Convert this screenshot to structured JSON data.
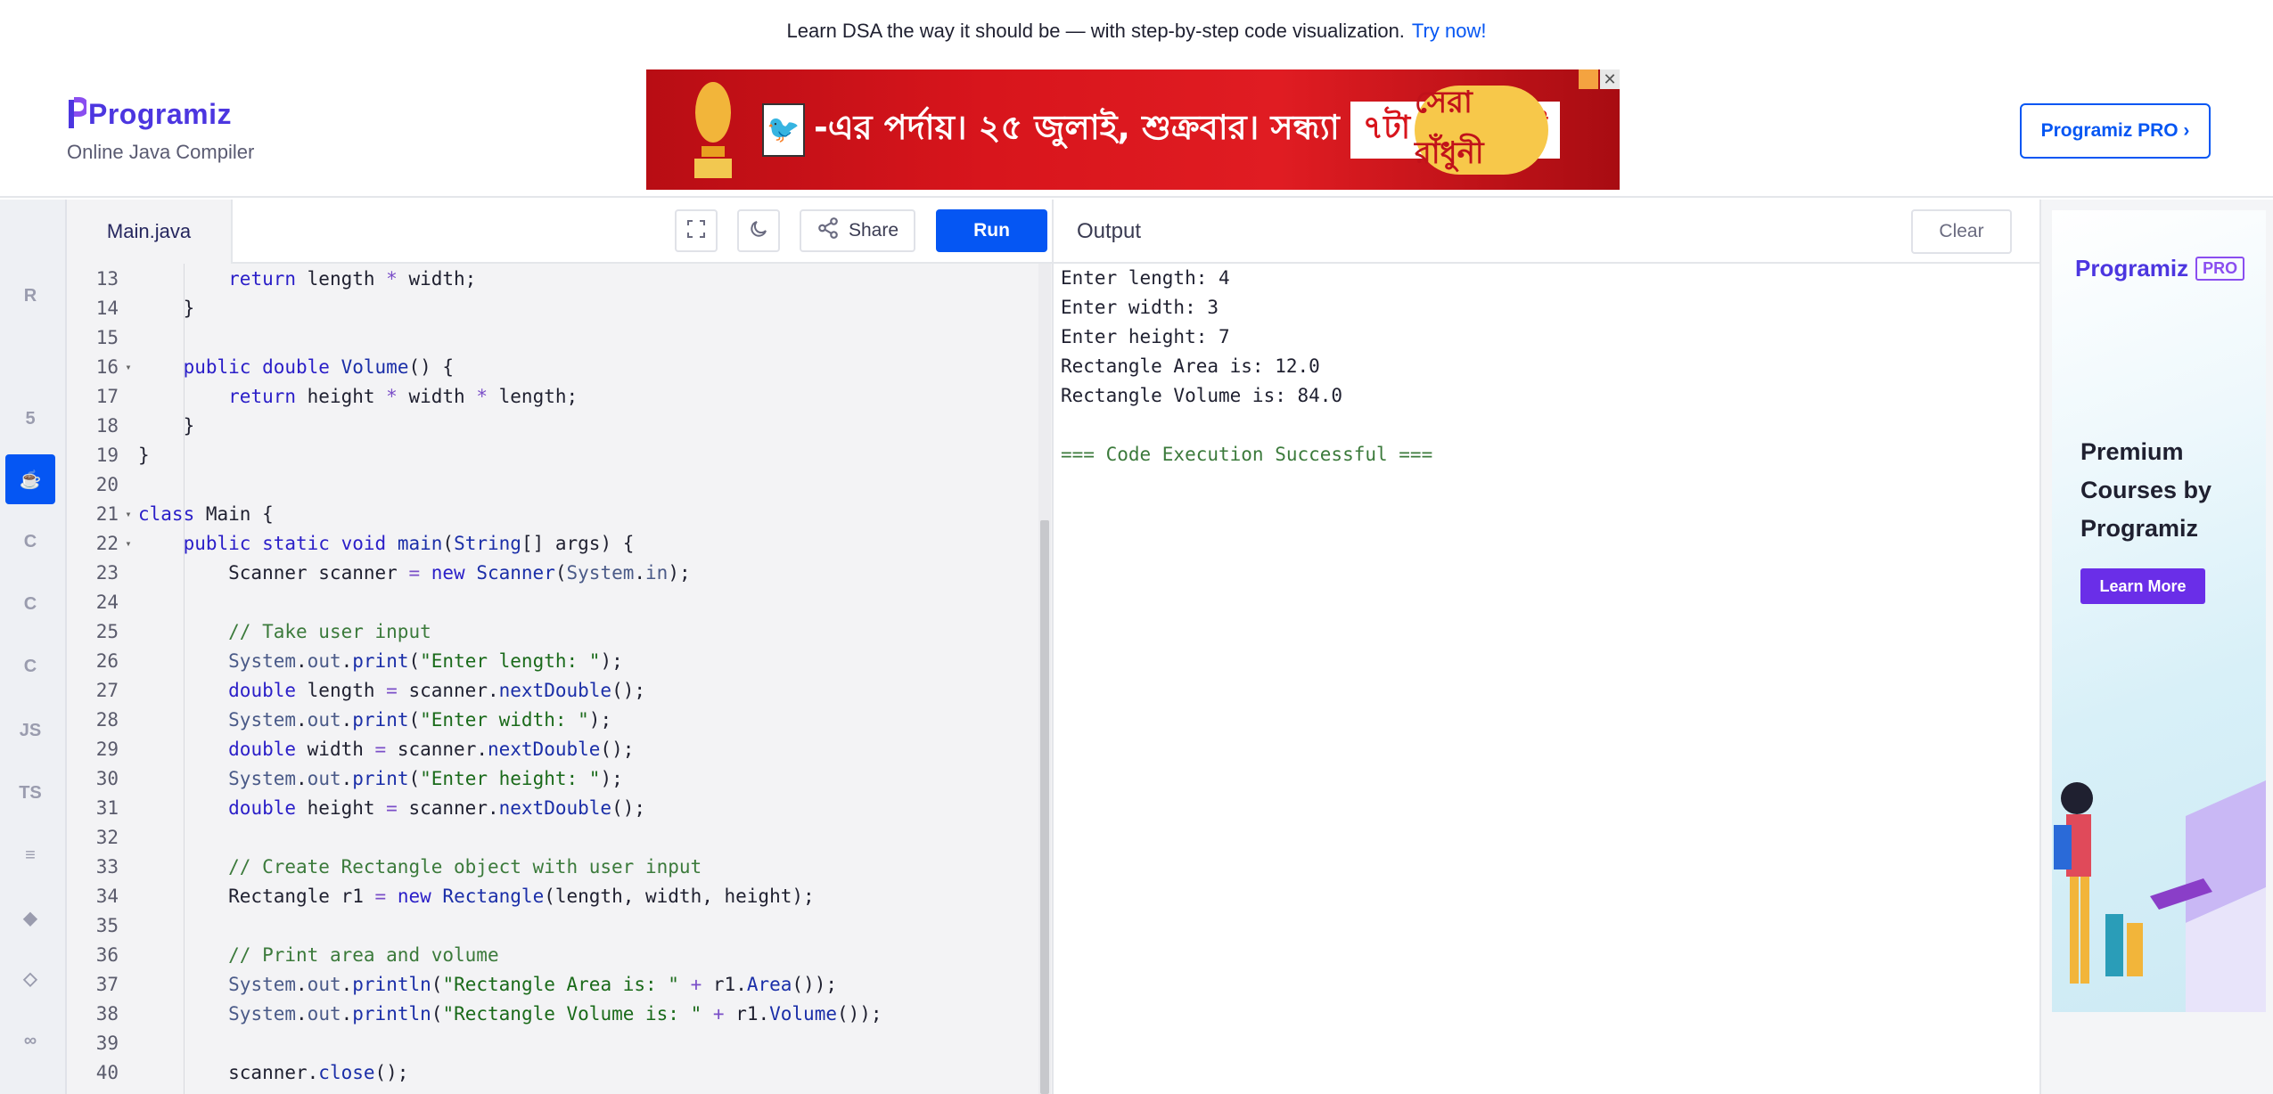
{
  "banner": {
    "text": "Learn DSA the way it should be — with step-by-step code visualization.",
    "cta": "Try now!"
  },
  "header": {
    "logo_text": "Programiz",
    "subtitle": "Online Java Compiler",
    "pro_button": "Programiz PRO ›"
  },
  "ad_top": {
    "text": "-এর পর্দায়। ২৫ জুলাই, শুক্রবার। সন্ধ্যা",
    "time": "৭টা ৩০ মিনিট",
    "brand": "সেরা রাঁধুনী",
    "close": "✕"
  },
  "rail": {
    "items": [
      {
        "icon": "python-icon",
        "label": ""
      },
      {
        "icon": "r-icon",
        "label": "R"
      },
      {
        "icon": "database-icon",
        "label": ""
      },
      {
        "icon": "html-icon",
        "label": "5"
      },
      {
        "icon": "java-icon",
        "label": "☕",
        "active": true
      },
      {
        "icon": "c-icon",
        "label": "C"
      },
      {
        "icon": "cpp-icon",
        "label": "C"
      },
      {
        "icon": "csharp-icon",
        "label": "C"
      },
      {
        "icon": "js-icon",
        "label": "JS"
      },
      {
        "icon": "ts-icon",
        "label": "TS"
      },
      {
        "icon": "stack-icon",
        "label": "≡"
      },
      {
        "icon": "swift-icon",
        "label": "◆"
      },
      {
        "icon": "kotlin-icon",
        "label": "◇"
      },
      {
        "icon": "go-icon",
        "label": "∞"
      }
    ]
  },
  "editor": {
    "file_tab": "Main.java",
    "share_label": "Share",
    "run_label": "Run",
    "lines": [
      {
        "n": "13",
        "fold": "",
        "code": [
          [
            "",
            "        "
          ],
          [
            "kw",
            "return"
          ],
          [
            "",
            " length "
          ],
          [
            "op",
            "*"
          ],
          [
            "",
            " width;"
          ]
        ]
      },
      {
        "n": "14",
        "fold": "",
        "code": [
          [
            "",
            "    }"
          ]
        ]
      },
      {
        "n": "15",
        "fold": "",
        "code": []
      },
      {
        "n": "16",
        "fold": "▾",
        "code": [
          [
            "",
            "    "
          ],
          [
            "kw",
            "public"
          ],
          [
            "",
            " "
          ],
          [
            "kw",
            "double"
          ],
          [
            "",
            " "
          ],
          [
            "fn",
            "Volume"
          ],
          [
            "",
            "() {"
          ]
        ]
      },
      {
        "n": "17",
        "fold": "",
        "code": [
          [
            "",
            "        "
          ],
          [
            "kw",
            "return"
          ],
          [
            "",
            " height "
          ],
          [
            "op",
            "*"
          ],
          [
            "",
            " width "
          ],
          [
            "op",
            "*"
          ],
          [
            "",
            " length;"
          ]
        ]
      },
      {
        "n": "18",
        "fold": "",
        "code": [
          [
            "",
            "    }"
          ]
        ]
      },
      {
        "n": "19",
        "fold": "",
        "code": [
          [
            "",
            "}"
          ]
        ]
      },
      {
        "n": "20",
        "fold": "",
        "code": []
      },
      {
        "n": "21",
        "fold": "▾",
        "code": [
          [
            "kw",
            "class"
          ],
          [
            "",
            " Main {"
          ]
        ]
      },
      {
        "n": "22",
        "fold": "▾",
        "code": [
          [
            "",
            "    "
          ],
          [
            "kw",
            "public"
          ],
          [
            "",
            " "
          ],
          [
            "kw",
            "static"
          ],
          [
            "",
            " "
          ],
          [
            "kw",
            "void"
          ],
          [
            "",
            " "
          ],
          [
            "fn",
            "main"
          ],
          [
            "",
            "("
          ],
          [
            "ty",
            "String"
          ],
          [
            "",
            "[] args) {"
          ]
        ]
      },
      {
        "n": "23",
        "fold": "",
        "code": [
          [
            "",
            "        Scanner scanner "
          ],
          [
            "op",
            "="
          ],
          [
            "",
            " "
          ],
          [
            "kw",
            "new"
          ],
          [
            "",
            " "
          ],
          [
            "ty",
            "Scanner"
          ],
          [
            "",
            "("
          ],
          [
            "sys",
            "System"
          ],
          [
            "",
            "."
          ],
          [
            "sys",
            "in"
          ],
          [
            "",
            ");"
          ]
        ]
      },
      {
        "n": "24",
        "fold": "",
        "code": []
      },
      {
        "n": "25",
        "fold": "",
        "code": [
          [
            "",
            "        "
          ],
          [
            "cm",
            "// Take user input"
          ]
        ]
      },
      {
        "n": "26",
        "fold": "",
        "code": [
          [
            "",
            "        "
          ],
          [
            "sys",
            "System"
          ],
          [
            "",
            "."
          ],
          [
            "sys",
            "out"
          ],
          [
            "",
            "."
          ],
          [
            "fn",
            "print"
          ],
          [
            "",
            "("
          ],
          [
            "str",
            "\"Enter length: \""
          ],
          [
            "",
            ");"
          ]
        ]
      },
      {
        "n": "27",
        "fold": "",
        "code": [
          [
            "",
            "        "
          ],
          [
            "kw",
            "double"
          ],
          [
            "",
            " length "
          ],
          [
            "op",
            "="
          ],
          [
            "",
            " scanner."
          ],
          [
            "fn",
            "nextDouble"
          ],
          [
            "",
            "();"
          ]
        ]
      },
      {
        "n": "28",
        "fold": "",
        "code": [
          [
            "",
            "        "
          ],
          [
            "sys",
            "System"
          ],
          [
            "",
            "."
          ],
          [
            "sys",
            "out"
          ],
          [
            "",
            "."
          ],
          [
            "fn",
            "print"
          ],
          [
            "",
            "("
          ],
          [
            "str",
            "\"Enter width: \""
          ],
          [
            "",
            ");"
          ]
        ]
      },
      {
        "n": "29",
        "fold": "",
        "code": [
          [
            "",
            "        "
          ],
          [
            "kw",
            "double"
          ],
          [
            "",
            " width "
          ],
          [
            "op",
            "="
          ],
          [
            "",
            " scanner."
          ],
          [
            "fn",
            "nextDouble"
          ],
          [
            "",
            "();"
          ]
        ]
      },
      {
        "n": "30",
        "fold": "",
        "code": [
          [
            "",
            "        "
          ],
          [
            "sys",
            "System"
          ],
          [
            "",
            "."
          ],
          [
            "sys",
            "out"
          ],
          [
            "",
            "."
          ],
          [
            "fn",
            "print"
          ],
          [
            "",
            "("
          ],
          [
            "str",
            "\"Enter height: \""
          ],
          [
            "",
            ");"
          ]
        ]
      },
      {
        "n": "31",
        "fold": "",
        "code": [
          [
            "",
            "        "
          ],
          [
            "kw",
            "double"
          ],
          [
            "",
            " height "
          ],
          [
            "op",
            "="
          ],
          [
            "",
            " scanner."
          ],
          [
            "fn",
            "nextDouble"
          ],
          [
            "",
            "();"
          ]
        ]
      },
      {
        "n": "32",
        "fold": "",
        "code": []
      },
      {
        "n": "33",
        "fold": "",
        "code": [
          [
            "",
            "        "
          ],
          [
            "cm",
            "// Create Rectangle object with user input"
          ]
        ]
      },
      {
        "n": "34",
        "fold": "",
        "code": [
          [
            "",
            "        Rectangle r1 "
          ],
          [
            "op",
            "="
          ],
          [
            "",
            " "
          ],
          [
            "kw",
            "new"
          ],
          [
            "",
            " "
          ],
          [
            "ty",
            "Rectangle"
          ],
          [
            "",
            "(length, width, height);"
          ]
        ]
      },
      {
        "n": "35",
        "fold": "",
        "code": []
      },
      {
        "n": "36",
        "fold": "",
        "code": [
          [
            "",
            "        "
          ],
          [
            "cm",
            "// Print area and volume"
          ]
        ]
      },
      {
        "n": "37",
        "fold": "",
        "code": [
          [
            "",
            "        "
          ],
          [
            "sys",
            "System"
          ],
          [
            "",
            "."
          ],
          [
            "sys",
            "out"
          ],
          [
            "",
            "."
          ],
          [
            "fn",
            "println"
          ],
          [
            "",
            "("
          ],
          [
            "str",
            "\"Rectangle Area is: \""
          ],
          [
            "",
            " "
          ],
          [
            "op",
            "+"
          ],
          [
            "",
            " r1."
          ],
          [
            "fn",
            "Area"
          ],
          [
            "",
            "());"
          ]
        ]
      },
      {
        "n": "38",
        "fold": "",
        "code": [
          [
            "",
            "        "
          ],
          [
            "sys",
            "System"
          ],
          [
            "",
            "."
          ],
          [
            "sys",
            "out"
          ],
          [
            "",
            "."
          ],
          [
            "fn",
            "println"
          ],
          [
            "",
            "("
          ],
          [
            "str",
            "\"Rectangle Volume is: \""
          ],
          [
            "",
            " "
          ],
          [
            "op",
            "+"
          ],
          [
            "",
            " r1."
          ],
          [
            "fn",
            "Volume"
          ],
          [
            "",
            "());"
          ]
        ]
      },
      {
        "n": "39",
        "fold": "",
        "code": []
      },
      {
        "n": "40",
        "fold": "",
        "code": [
          [
            "",
            "        scanner."
          ],
          [
            "fn",
            "close"
          ],
          [
            "",
            "();"
          ]
        ]
      }
    ]
  },
  "output": {
    "title": "Output",
    "clear_label": "Clear",
    "lines": [
      "Enter length: 4",
      "Enter width: 3",
      "Enter height: 7",
      "Rectangle Area is: 12.0",
      "Rectangle Volume is: 84.0",
      ""
    ],
    "success": "=== Code Execution Successful ==="
  },
  "side_ad": {
    "logo": "Programiz",
    "badge": "PRO",
    "headline": "Premium Courses by Programiz",
    "button": "Learn More"
  }
}
